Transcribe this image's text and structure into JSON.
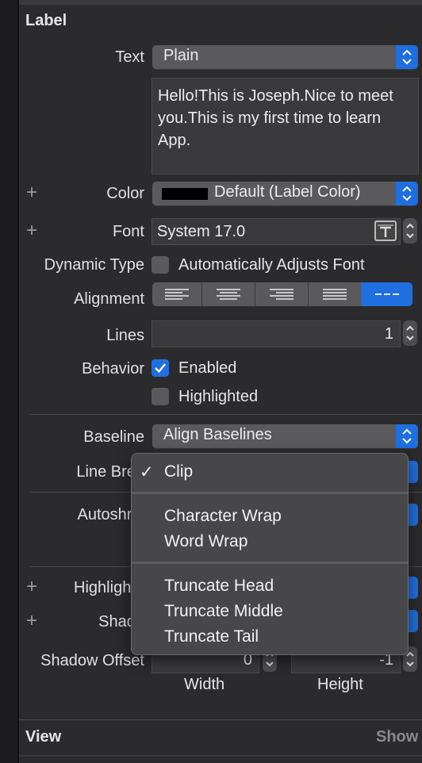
{
  "sections": {
    "label_title": "Label",
    "view_title": "View",
    "view_show": "Show"
  },
  "text": {
    "label": "Text",
    "mode": "Plain",
    "content": "Hello!This is Joseph.Nice to meet you.This is my first time to learn App."
  },
  "color": {
    "label": "Color",
    "value": "Default (Label Color)",
    "swatch": "#000000"
  },
  "font": {
    "label": "Font",
    "value": "System 17.0"
  },
  "dynamic_type": {
    "label": "Dynamic Type",
    "option": "Automatically Adjusts Font",
    "checked": false
  },
  "alignment": {
    "label": "Alignment",
    "options": [
      "left",
      "center",
      "right",
      "justified",
      "natural"
    ],
    "selected": "natural"
  },
  "lines": {
    "label": "Lines",
    "value": "1"
  },
  "behavior": {
    "label": "Behavior",
    "enabled": "Enabled",
    "enabled_checked": true,
    "highlighted": "Highlighted",
    "highlighted_checked": false
  },
  "baseline": {
    "label": "Baseline",
    "value": "Align Baselines"
  },
  "line_break": {
    "label": "Line Brea"
  },
  "autoshrink": {
    "label": "Autoshrin"
  },
  "highlighted_color": {
    "label": "Highlighte"
  },
  "shadow": {
    "label": "Shado"
  },
  "shadow_offset": {
    "label": "Shadow Offset",
    "width": "0",
    "height": "-1",
    "width_label": "Width",
    "height_label": "Height"
  },
  "line_break_menu": {
    "checkmark": "✓",
    "selected": "Clip",
    "groups": [
      [
        "Clip"
      ],
      [
        "Character Wrap",
        "Word Wrap"
      ],
      [
        "Truncate Head",
        "Truncate Middle",
        "Truncate Tail"
      ]
    ]
  },
  "accent_color": "#1f6fe0"
}
